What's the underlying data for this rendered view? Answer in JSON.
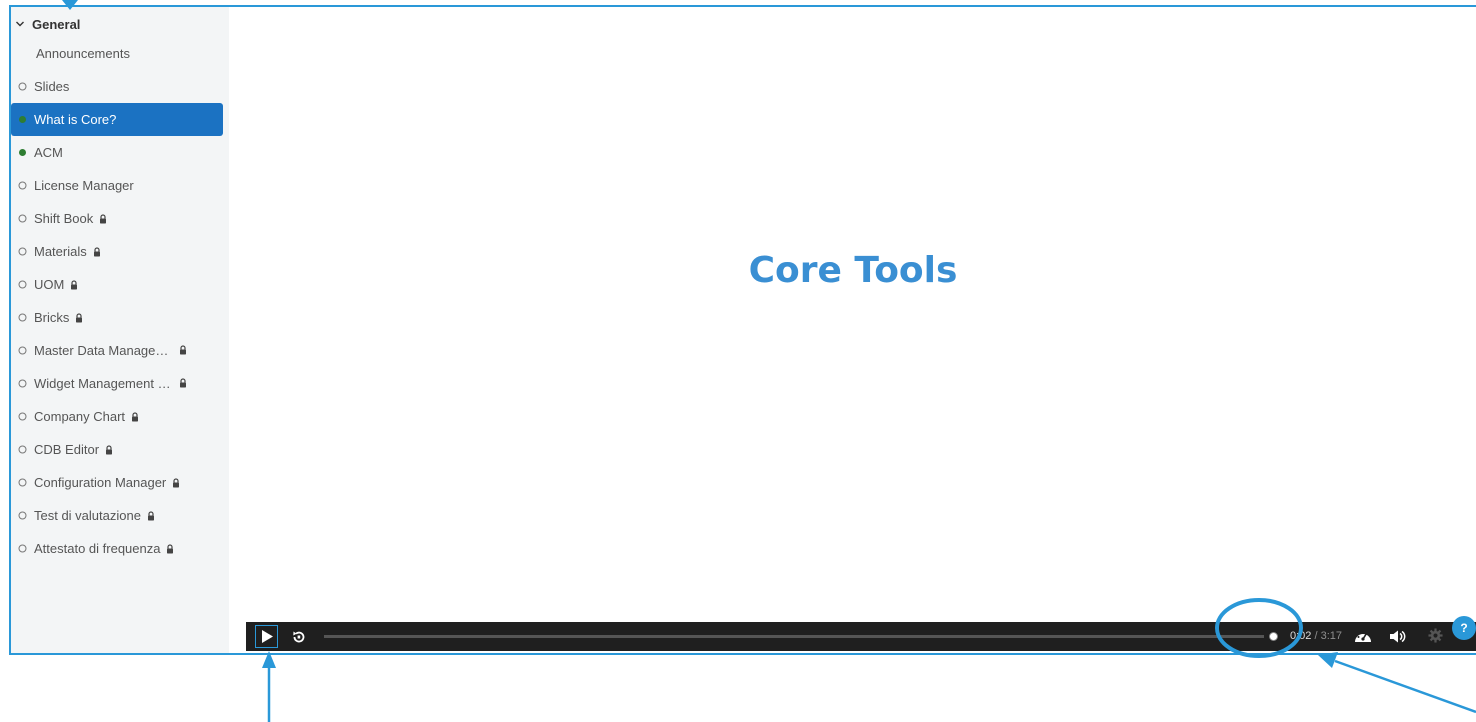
{
  "sidebar": {
    "section_title": "General",
    "items": [
      {
        "label": "Announcements",
        "status": "none",
        "locked": false
      },
      {
        "label": "Slides",
        "status": "empty",
        "locked": false
      },
      {
        "label": "What is Core?",
        "status": "active",
        "locked": false
      },
      {
        "label": "ACM",
        "status": "complete",
        "locked": false
      },
      {
        "label": "License Manager",
        "status": "empty",
        "locked": false
      },
      {
        "label": "Shift Book",
        "status": "empty",
        "locked": true
      },
      {
        "label": "Materials",
        "status": "empty",
        "locked": true
      },
      {
        "label": "UOM",
        "status": "empty",
        "locked": true
      },
      {
        "label": "Bricks",
        "status": "empty",
        "locked": true
      },
      {
        "label": "Master Data Manage…",
        "status": "empty",
        "locked": true
      },
      {
        "label": "Widget Management …",
        "status": "empty",
        "locked": true
      },
      {
        "label": "Company Chart",
        "status": "empty",
        "locked": true
      },
      {
        "label": "CDB Editor",
        "status": "empty",
        "locked": true
      },
      {
        "label": "Configuration Manager",
        "status": "empty",
        "locked": true
      },
      {
        "label": "Test di valutazione",
        "status": "empty",
        "locked": true
      },
      {
        "label": "Attestato di frequenza",
        "status": "empty",
        "locked": true
      }
    ]
  },
  "slide": {
    "title": "Core Tools"
  },
  "player": {
    "current_time": "0:02",
    "duration": "3:17",
    "progress": 0.0,
    "icons": [
      "play-icon",
      "replay-icon",
      "speed-icon",
      "volume-icon",
      "gear-icon"
    ]
  },
  "help": {
    "label": "?"
  },
  "colors": {
    "accent": "#2a98d8",
    "active_item": "#1b72c2",
    "complete_dot": "#2e7d32",
    "title": "#3a8fd3"
  }
}
